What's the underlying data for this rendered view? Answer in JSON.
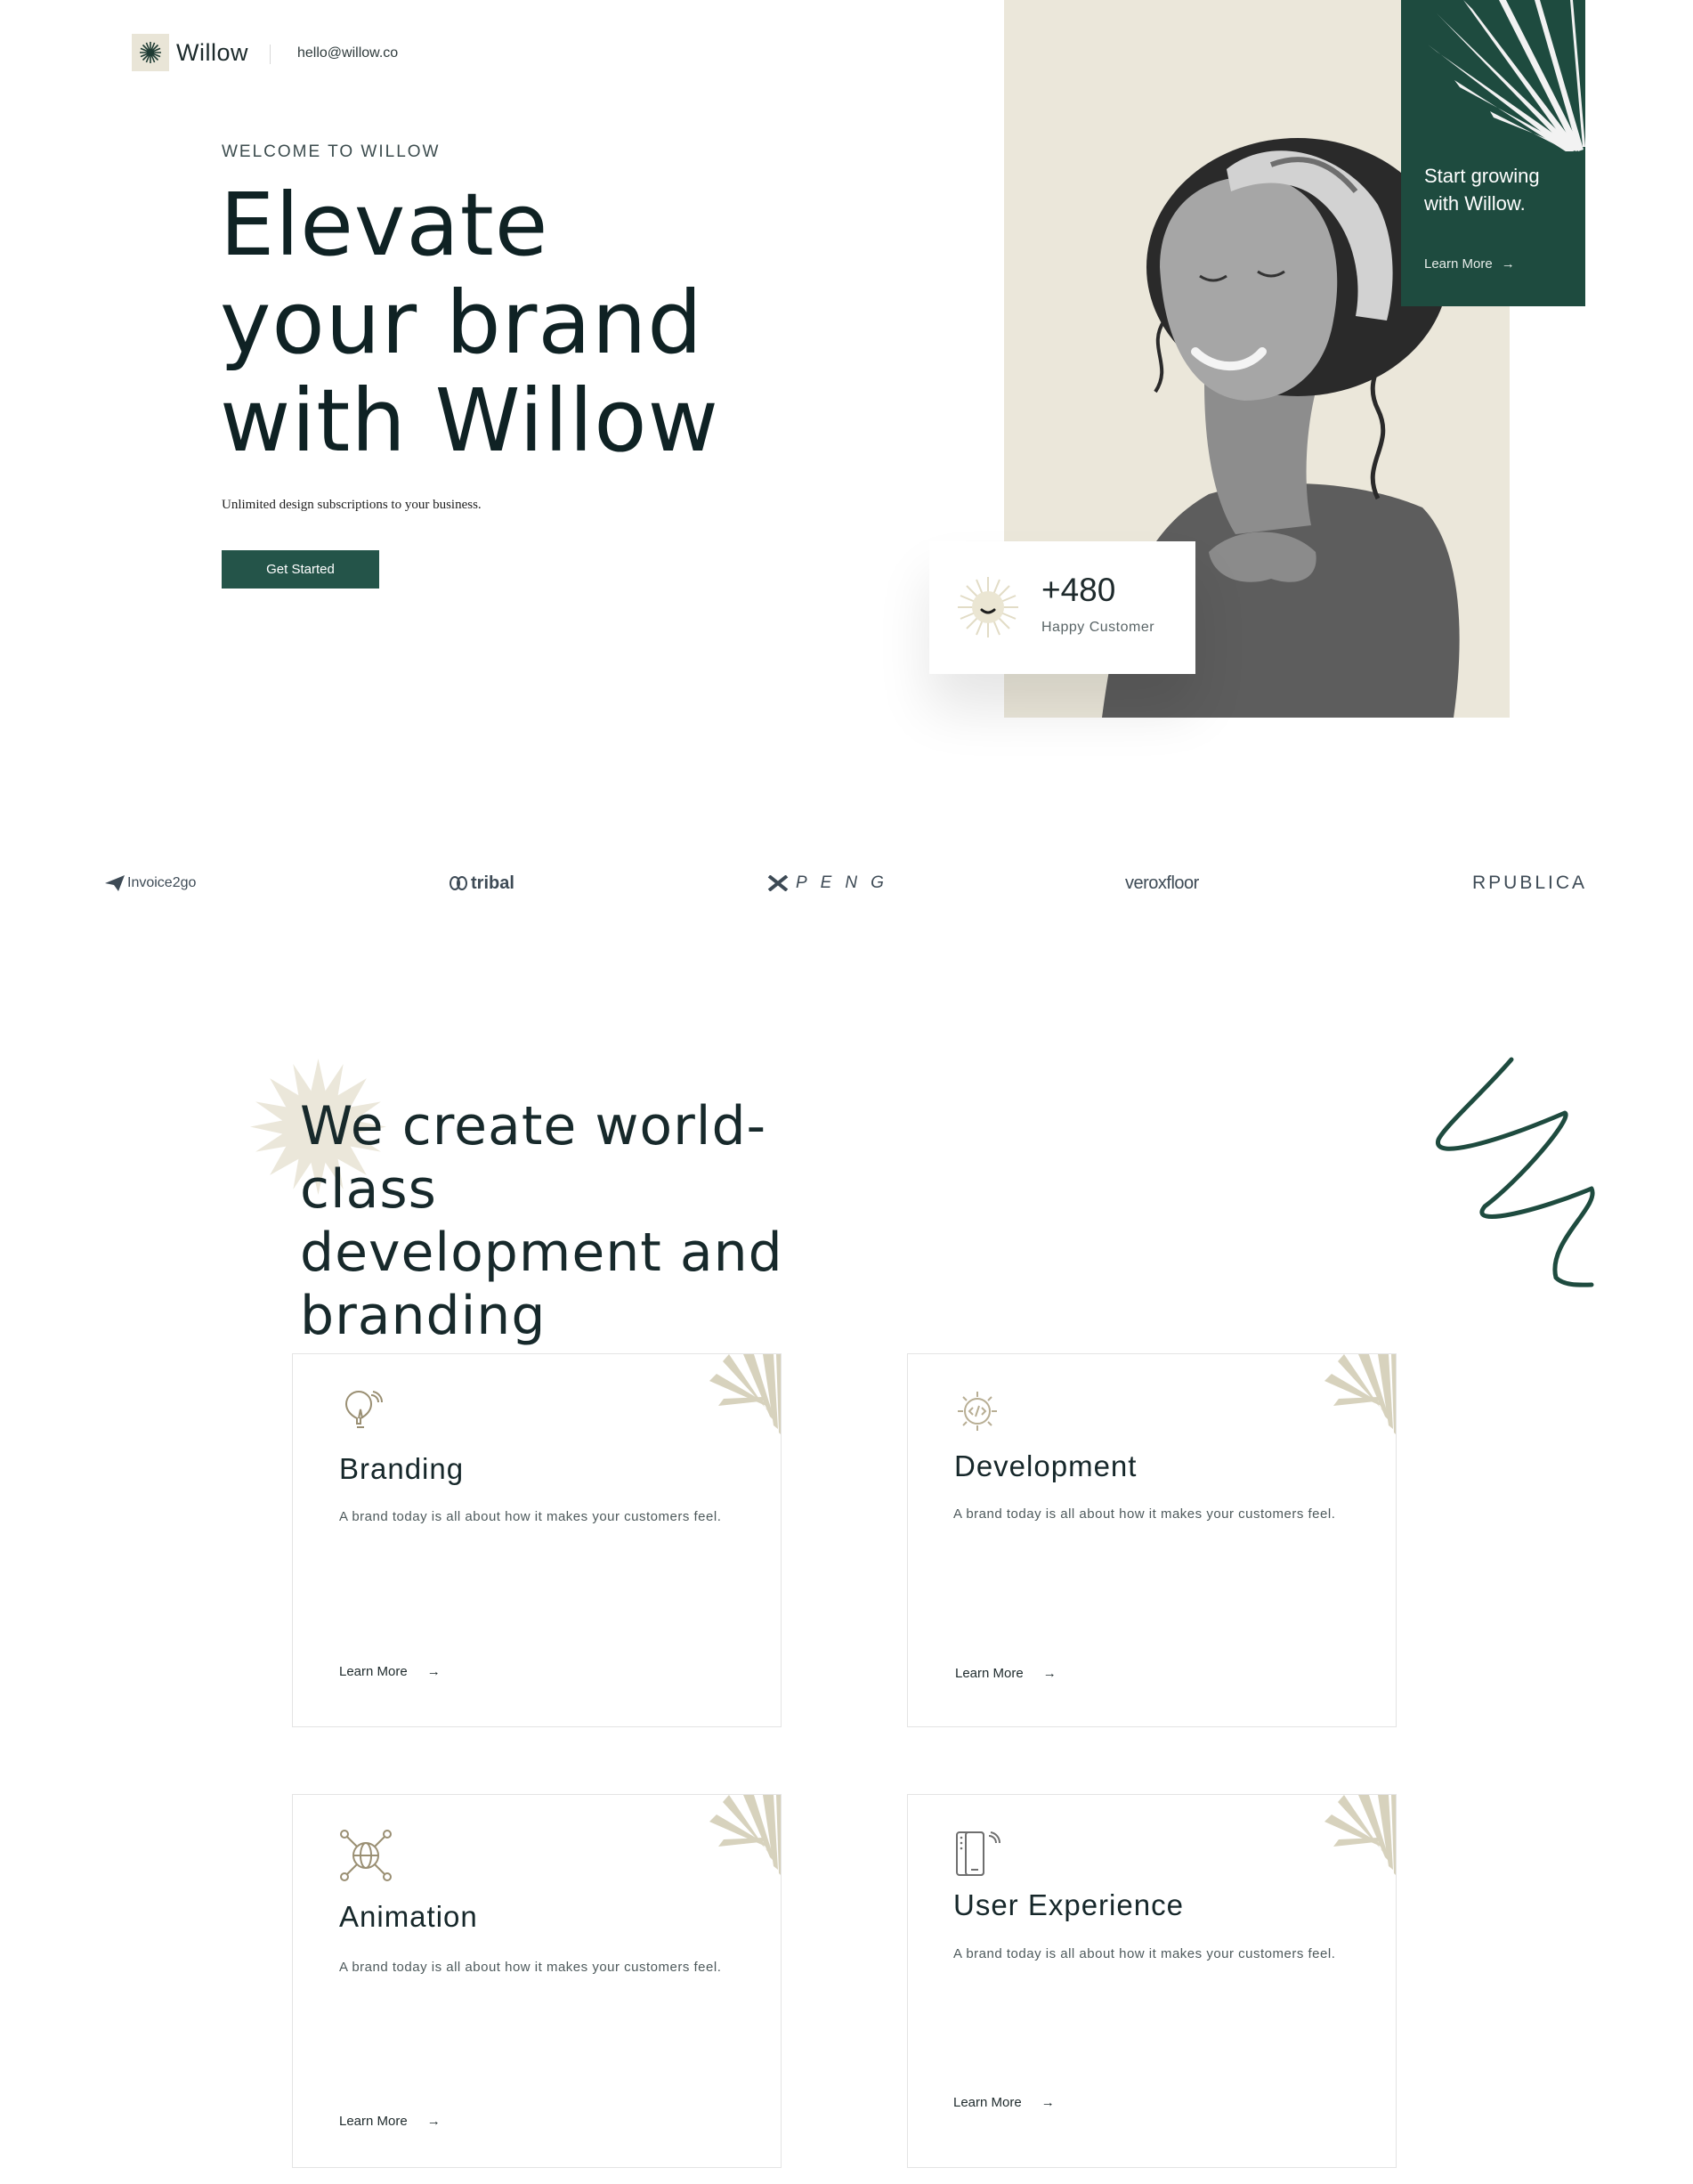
{
  "header": {
    "brand": "Willow",
    "email": "hello@willow.co"
  },
  "hero": {
    "eyebrow": "WELCOME TO WILLOW",
    "title_lines": [
      "Elevate",
      "your brand",
      "with Willow"
    ],
    "subtitle": "Unlimited design subscriptions to your business.",
    "cta": "Get Started",
    "promo": {
      "text": "Start growing with Willow.",
      "link": "Learn More"
    },
    "stat": {
      "value": "+480",
      "label": "Happy Customer"
    }
  },
  "brands": [
    {
      "name": "Invoice2go",
      "icon": "paper-plane-icon"
    },
    {
      "name": "tribal",
      "icon": "tribal-mark-icon"
    },
    {
      "name": "PENG",
      "icon": "x-mark-icon"
    },
    {
      "name": "veroxfloor",
      "icon": ""
    },
    {
      "name": "RPUBLICA",
      "icon": ""
    }
  ],
  "services": {
    "title": "We create world-class development and branding",
    "cards": [
      {
        "title": "Branding",
        "desc": "A brand today is all about how it makes your customers feel.",
        "link": "Learn More",
        "icon": "lightbulb-icon"
      },
      {
        "title": "Development",
        "desc": "A brand today is all about how it makes your customers feel.",
        "link": "Learn More",
        "icon": "gear-code-icon"
      },
      {
        "title": "Animation",
        "desc": "A brand today is all about how it makes your customers feel.",
        "link": "Learn More",
        "icon": "globe-network-icon"
      },
      {
        "title": "User Experience",
        "desc": "A brand today is all about how it makes your customers feel.",
        "link": "Learn More",
        "icon": "mobile-devices-icon"
      }
    ]
  },
  "colors": {
    "primary": "#245449",
    "promo": "#1e4b3f",
    "beige": "#ebe7da",
    "text": "#0f2224"
  }
}
